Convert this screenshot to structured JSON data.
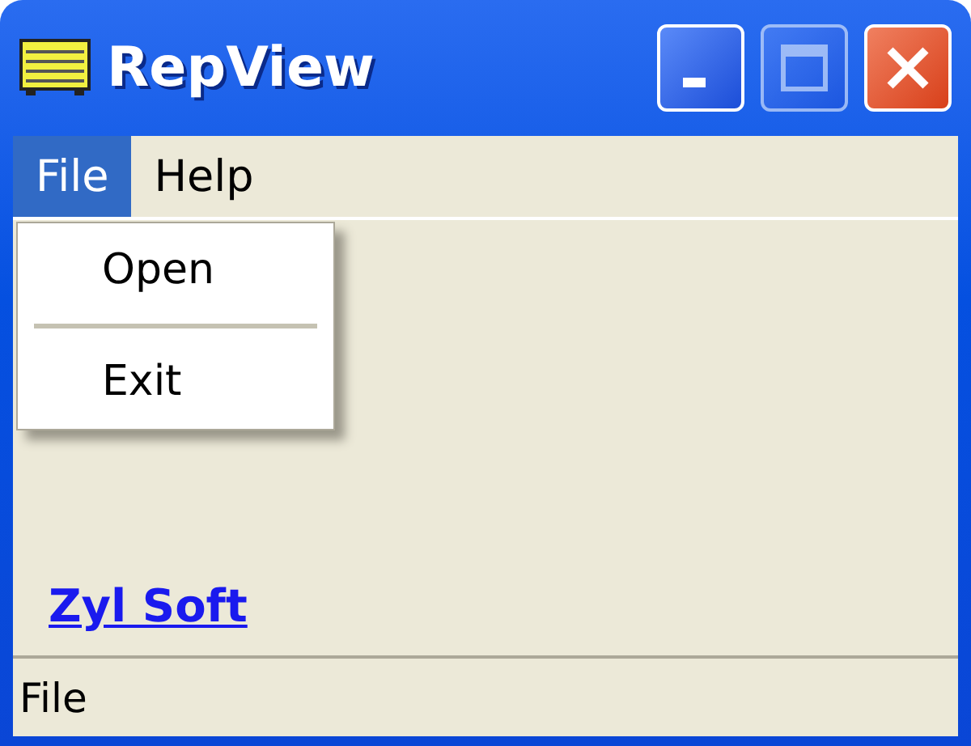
{
  "window": {
    "title": "RepView",
    "controls": [
      {
        "kind": "minimize",
        "disabled": false
      },
      {
        "kind": "maximize",
        "disabled": true
      },
      {
        "kind": "close",
        "disabled": false
      }
    ]
  },
  "menu": [
    {
      "label": "File",
      "selected": true
    },
    {
      "label": "Help",
      "selected": false
    }
  ],
  "dropdown": {
    "items": [
      {
        "kind": "item",
        "label": "Open"
      },
      {
        "kind": "separator"
      },
      {
        "kind": "item",
        "label": "Exit"
      }
    ]
  },
  "link": "Zyl Soft",
  "status_bar": "File"
}
